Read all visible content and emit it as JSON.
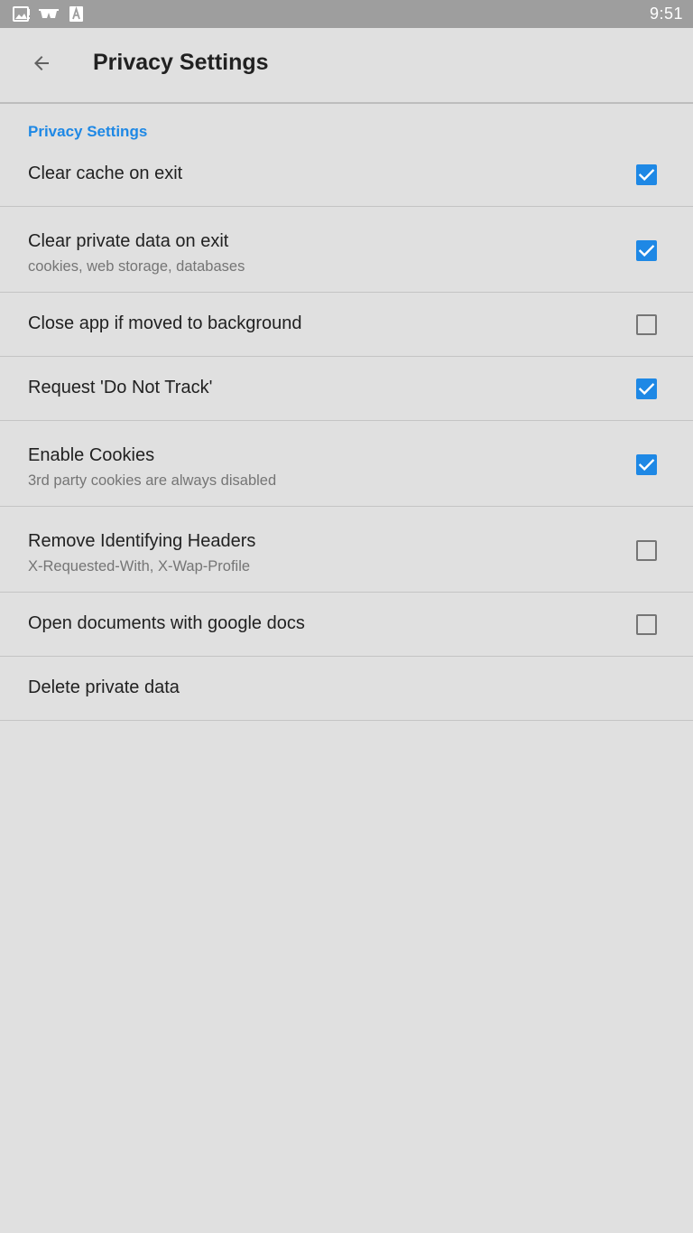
{
  "status_bar": {
    "time": "9:51",
    "icons": [
      "image-notification-icon",
      "glasses-notification-icon",
      "a-notification-icon"
    ]
  },
  "app_bar": {
    "title": "Privacy Settings",
    "back_icon": "arrow-back-icon"
  },
  "section": {
    "header": "Privacy Settings"
  },
  "prefs": [
    {
      "title": "Clear cache on exit",
      "summary": "",
      "checked": true
    },
    {
      "title": "Clear private data on exit",
      "summary": "cookies, web storage, databases",
      "checked": true
    },
    {
      "title": "Close app if moved to background",
      "summary": "",
      "checked": false
    },
    {
      "title": "Request 'Do Not Track'",
      "summary": "",
      "checked": true
    },
    {
      "title": "Enable Cookies",
      "summary": "3rd party cookies are always disabled",
      "checked": true
    },
    {
      "title": "Remove Identifying Headers",
      "summary": "X-Requested-With, X-Wap-Profile",
      "checked": false
    },
    {
      "title": "Open documents with google docs",
      "summary": "",
      "checked": false
    },
    {
      "title": "Delete private data",
      "summary": ""
    }
  ],
  "colors": {
    "accent": "#1e88e5",
    "background": "#e0e0e0",
    "status_bar": "#9e9e9e"
  }
}
